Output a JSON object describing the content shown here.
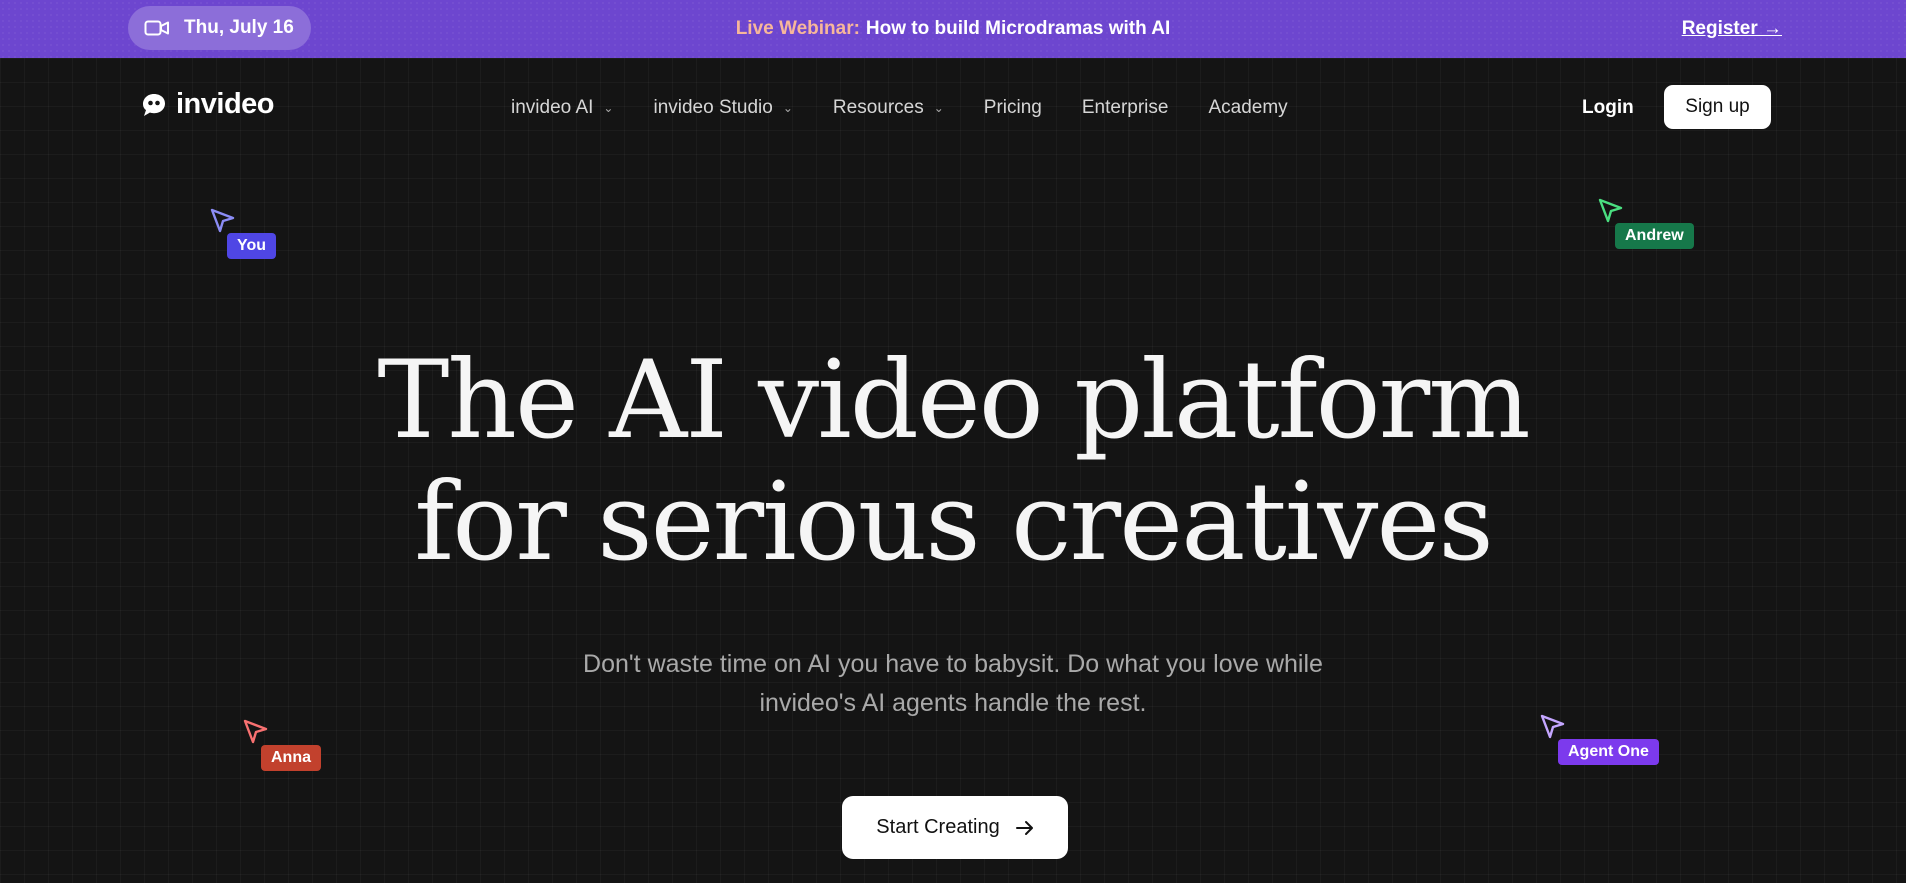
{
  "banner": {
    "date": "Thu, July 16",
    "live_label": "Live Webinar:",
    "title": "How to build Microdramas with AI",
    "register": "Register →"
  },
  "brand": {
    "name": "invideo"
  },
  "nav": {
    "items": [
      {
        "label": "invideo AI",
        "dropdown": true
      },
      {
        "label": "invideo Studio",
        "dropdown": true
      },
      {
        "label": "Resources",
        "dropdown": true
      },
      {
        "label": "Pricing",
        "dropdown": false
      },
      {
        "label": "Enterprise",
        "dropdown": false
      },
      {
        "label": "Academy",
        "dropdown": false
      }
    ],
    "login": "Login",
    "signup": "Sign up"
  },
  "cursors": [
    {
      "name": "You",
      "color": "#4f46e5"
    },
    {
      "name": "Andrew",
      "color": "#16784a"
    },
    {
      "name": "Anna",
      "color": "#c2412d"
    },
    {
      "name": "Agent One",
      "color": "#7c3aed"
    }
  ],
  "hero": {
    "headline_line1": "The AI video platform",
    "headline_line2": "for serious creatives",
    "sub_line1": "Don't waste time on AI you have to babysit. Do what you love while",
    "sub_line2": "invideo's AI agents handle the rest.",
    "cta": "Start Creating"
  },
  "colors": {
    "banner_bg": "#6d46cf",
    "page_bg": "#141414",
    "live_accent": "#f7b79a"
  }
}
